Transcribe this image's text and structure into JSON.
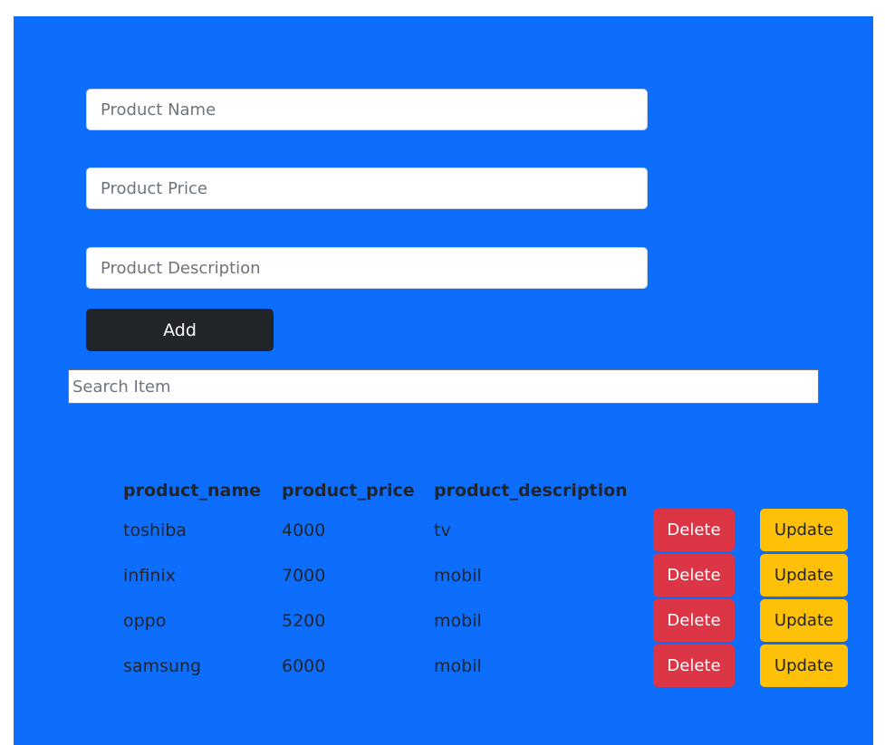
{
  "form": {
    "name_placeholder": "Product Name",
    "price_placeholder": "Product Price",
    "description_placeholder": "Product Description",
    "add_label": "Add"
  },
  "search": {
    "placeholder": "Search Item"
  },
  "table": {
    "headers": [
      "product_name",
      "product_price",
      "product_description"
    ],
    "delete_label": "Delete",
    "update_label": "Update",
    "rows": [
      {
        "name": "toshiba",
        "price": "4000",
        "description": "tv"
      },
      {
        "name": "infinix",
        "price": "7000",
        "description": "mobil"
      },
      {
        "name": "oppo",
        "price": "5200",
        "description": "mobil"
      },
      {
        "name": "samsung",
        "price": "6000",
        "description": "mobil"
      }
    ]
  },
  "colors": {
    "background": "#0d6efd",
    "add_button": "#212529",
    "delete_button": "#dc3545",
    "update_button": "#ffc107"
  }
}
